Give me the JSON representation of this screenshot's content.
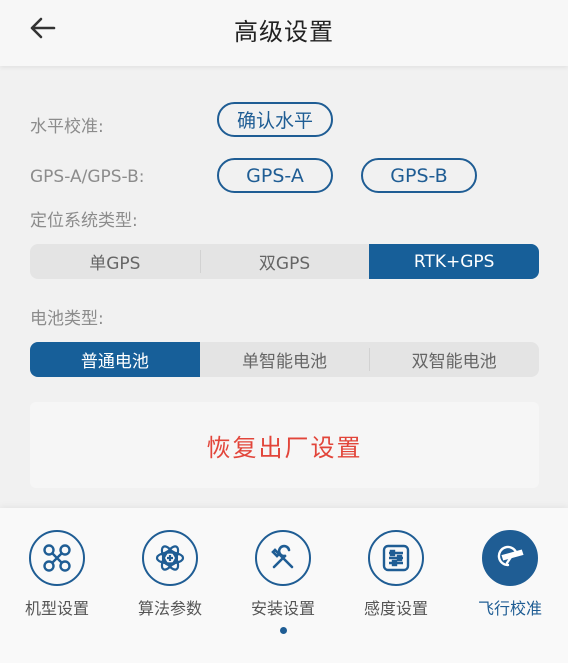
{
  "header": {
    "title": "高级设置"
  },
  "level": {
    "label": "水平校准:",
    "button": "确认水平"
  },
  "gps_select": {
    "label": "GPS-A/GPS-B:",
    "option_a": "GPS-A",
    "option_b": "GPS-B"
  },
  "positioning": {
    "label": "定位系统类型:",
    "options": [
      "单GPS",
      "双GPS",
      "RTK+GPS"
    ],
    "selected": "RTK+GPS"
  },
  "battery": {
    "label": "电池类型:",
    "options": [
      "普通电池",
      "单智能电池",
      "双智能电池"
    ],
    "selected": "普通电池"
  },
  "reset": {
    "label": "恢复出厂设置"
  },
  "nav": {
    "items": [
      {
        "label": "机型设置",
        "icon": "drone-icon"
      },
      {
        "label": "算法参数",
        "icon": "algorithm-icon"
      },
      {
        "label": "安装设置",
        "icon": "tools-icon"
      },
      {
        "label": "感度设置",
        "icon": "sliders-icon"
      },
      {
        "label": "飞行校准",
        "icon": "plane-calibration-icon"
      }
    ],
    "active": "飞行校准"
  },
  "colors": {
    "accent": "#1f5d94",
    "danger": "#e2453a",
    "segment_bg": "#e4e4e4"
  }
}
